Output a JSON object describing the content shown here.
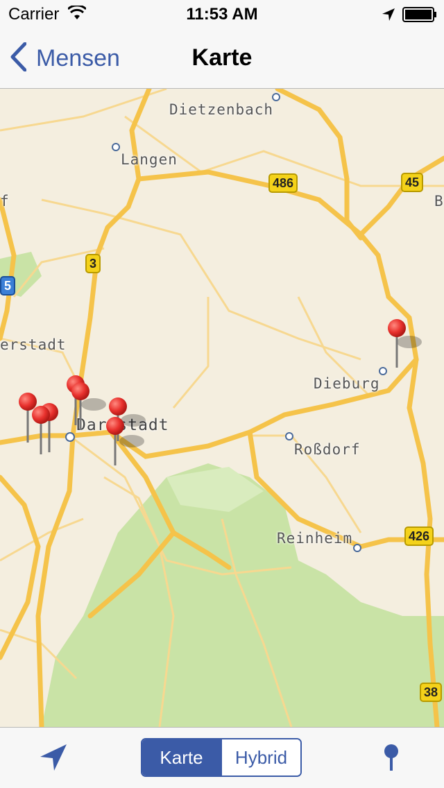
{
  "status_bar": {
    "carrier": "Carrier",
    "time": "11:53 AM",
    "icons": [
      "wifi-icon",
      "location-arrow-icon",
      "battery-icon"
    ]
  },
  "nav": {
    "back_label": "Mensen",
    "title": "Karte"
  },
  "map": {
    "places": [
      "Dietzenbach",
      "Langen",
      "Dieburg",
      "Darmstadt",
      "Roßdorf",
      "Reinheim",
      "erstadt",
      "f",
      "B"
    ],
    "route_shields": [
      "486",
      "45",
      "3",
      "5",
      "426",
      "38"
    ],
    "pin_count": 9,
    "colors": {
      "land": "#f4eedf",
      "forest": "#c9e3a6",
      "road": "#f5c34a",
      "pin": "#e8312d"
    }
  },
  "toolbar": {
    "locate_icon": "location-arrow-icon",
    "segments": [
      "Karte",
      "Hybrid"
    ],
    "selected_segment": "Karte",
    "pin_icon": "map-pin-icon"
  },
  "accent_color": "#3b5ba7"
}
